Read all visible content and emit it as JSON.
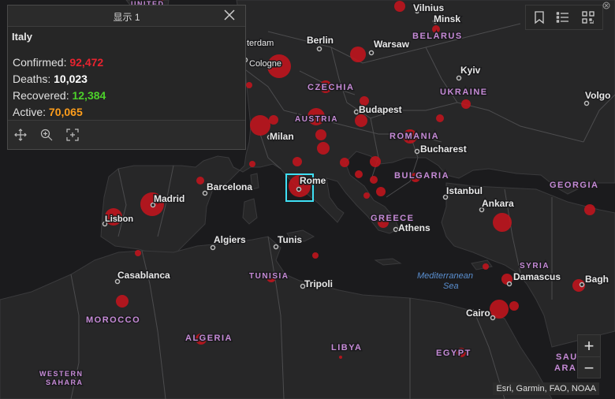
{
  "popup": {
    "title": "显示 1",
    "country": "Italy",
    "confirmed_label": "Confirmed:",
    "confirmed_value": "92,472",
    "deaths_label": "Deaths:",
    "deaths_value": "10,023",
    "recovered_label": "Recovered:",
    "recovered_value": "12,384",
    "active_label": "Active:",
    "active_value": "70,065",
    "colors": {
      "confirmed": "#e8232f",
      "deaths": "#ffffff",
      "recovered": "#4cd12a",
      "active": "#ff9e1b"
    }
  },
  "toolbar": {
    "icons": [
      "bookmark-icon",
      "list-icon",
      "qr-grid-icon"
    ]
  },
  "zoom": {
    "in_label": "+",
    "out_label": "−"
  },
  "attribution": "Esri, Garmin, FAO, NOAA",
  "map": {
    "cities": [
      "Vilnius",
      "Minsk",
      "Berlin",
      "Warsaw",
      "Kyiv",
      "Cologne",
      "Milan",
      "Budapest",
      "Bucharest",
      "Barcelona",
      "Madrid",
      "Lisbon",
      "Rome",
      "Istanbul",
      "Ankara",
      "Athens",
      "Algiers",
      "Tunis",
      "Tripoli",
      "Casablanca",
      "Damascus",
      "Cairo",
      "Volgo",
      "Bagh",
      "terdam"
    ],
    "countries": [
      "BELARUS",
      "CZECHIA",
      "UKRAINE",
      "AUSTRIA",
      "ROMANIA",
      "BULGARIA",
      "GREECE",
      "GEORGIA",
      "TUNISIA",
      "SYRIA",
      "MOROCCO",
      "ALGERIA",
      "LIBYA",
      "EGYPT",
      "WESTERN",
      "SAHARA",
      "SAU",
      "ARA",
      "UNITED"
    ],
    "sea": [
      "Mediterranean",
      "Sea"
    ],
    "colors": {
      "land": "#272728",
      "water": "#1b1b1d",
      "border": "#4c4c4e",
      "bubble": "#c3141d",
      "selection": "#3fe0f5"
    }
  }
}
